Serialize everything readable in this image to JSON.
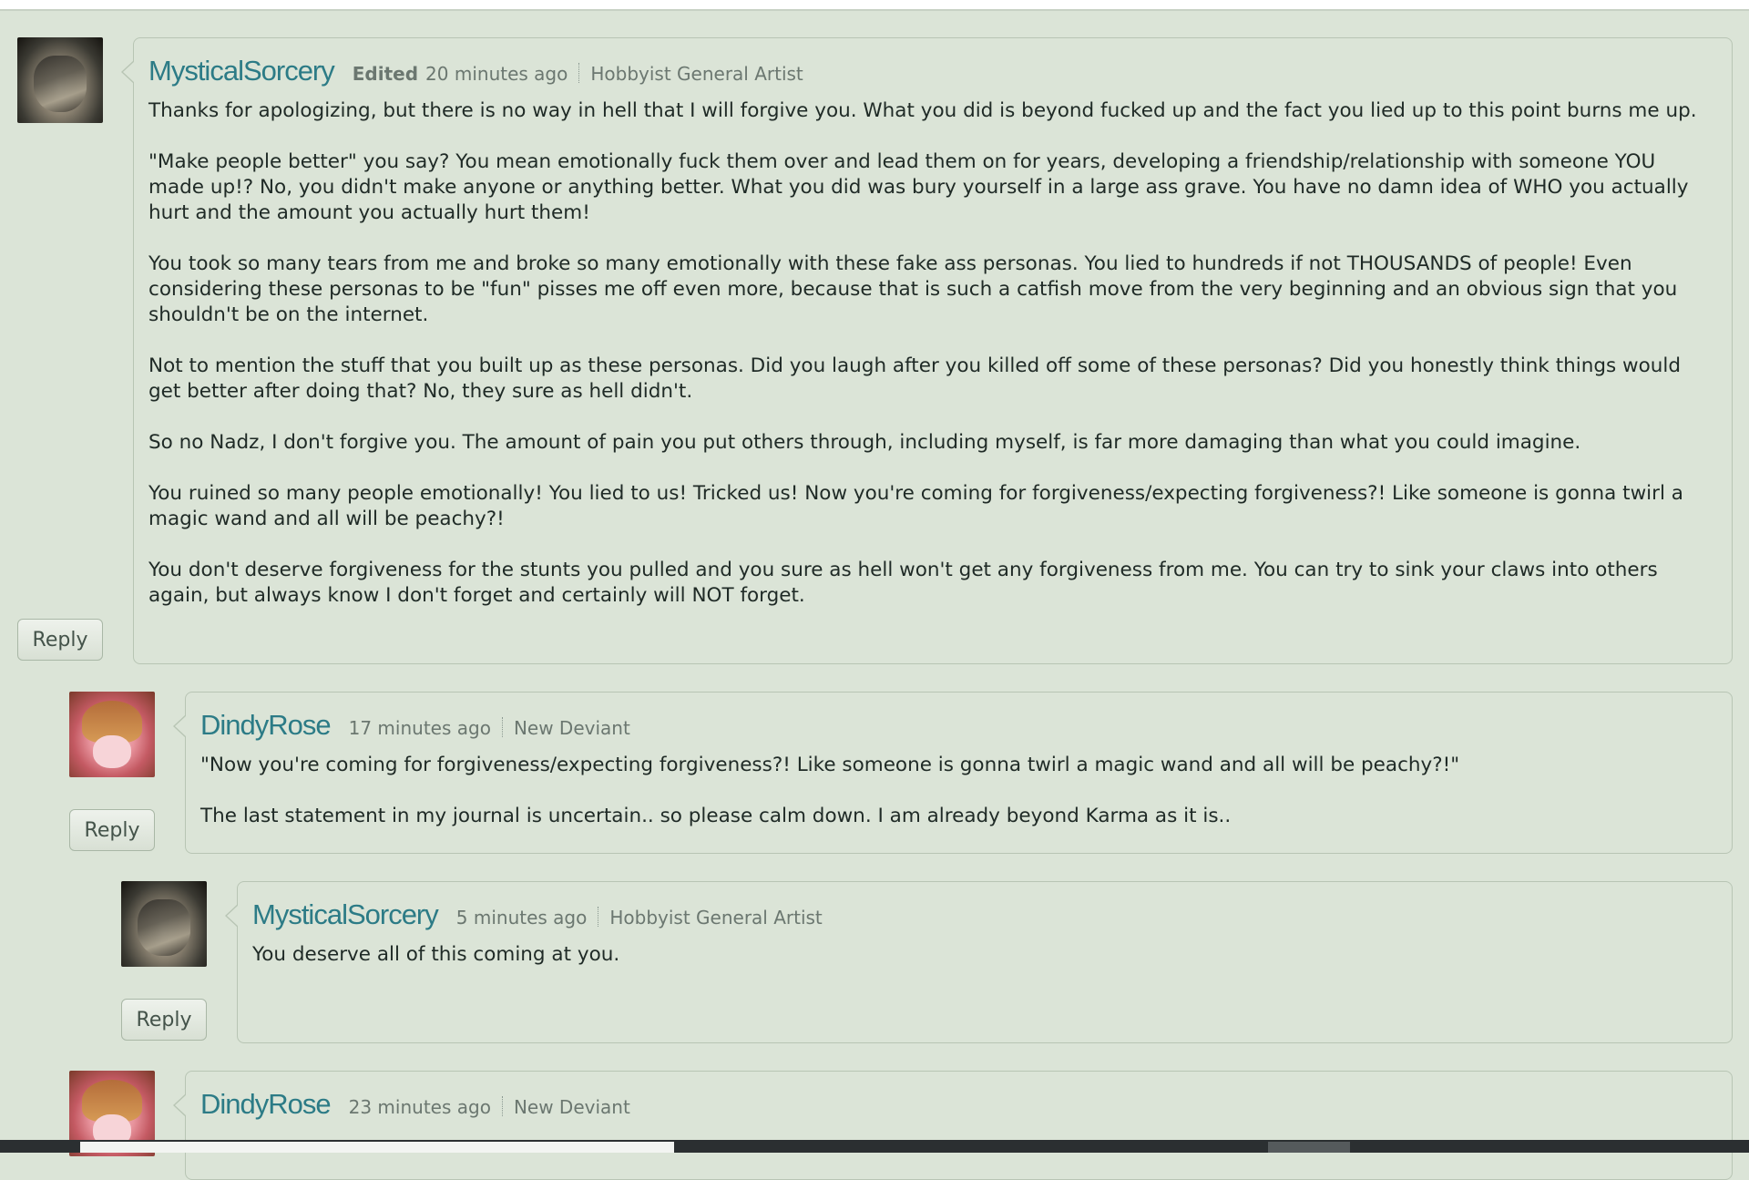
{
  "comments": [
    {
      "username": "MysticalSorcery",
      "edited": "Edited",
      "time": "20 minutes ago",
      "rank": "Hobbyist General Artist",
      "reply": "Reply",
      "paragraphs": [
        "Thanks for apologizing, but there is no way in hell that I will forgive you. What you did is beyond fucked up and the fact you lied up to this point burns me up.",
        "\"Make people better\" you say? You mean emotionally fuck them over and lead them on for years, developing a friendship/relationship with someone YOU made up!? No, you didn't make anyone or anything better. What you did was bury yourself in a large ass grave. You have no damn idea of WHO you actually hurt and the amount you actually hurt them!",
        "You took so many tears from me and broke so many emotionally with these fake ass personas. You lied to hundreds if not THOUSANDS of people! Even considering these personas to be \"fun\" pisses me off even more, because that is such a catfish move from the very beginning and an obvious sign that you shouldn't be on the internet.",
        "Not to mention the stuff that you built up as these personas. Did you laugh after you killed off some of these personas? Did you honestly think things would get better after doing that? No, they sure as hell didn't.",
        "So no Nadz, I don't forgive you. The amount of pain you put others through, including myself, is far more damaging than what you could imagine.",
        "You ruined so many people emotionally! You lied to us! Tricked us! Now you're coming for forgiveness/expecting forgiveness?! Like someone is gonna twirl a magic wand and all will be peachy?!",
        "You don't deserve forgiveness for the stunts you pulled and you sure as hell won't get any forgiveness from me. You can try to sink your claws into others again, but always know I don't forget and certainly will NOT forget."
      ]
    },
    {
      "username": "DindyRose",
      "time": "17 minutes ago",
      "rank": "New Deviant",
      "reply": "Reply",
      "paragraphs": [
        "\"Now you're coming for forgiveness/expecting forgiveness?! Like someone is gonna twirl a magic wand and all will be peachy?!\"",
        "The last statement in my journal is uncertain.. so please calm down. I am already beyond Karma as it is.."
      ]
    },
    {
      "username": "MysticalSorcery",
      "time": "5 minutes ago",
      "rank": "Hobbyist General Artist",
      "reply": "Reply",
      "paragraphs": [
        "You deserve all of this coming at you."
      ]
    },
    {
      "username": "DindyRose",
      "time": "23 minutes ago",
      "rank": "New Deviant"
    }
  ]
}
